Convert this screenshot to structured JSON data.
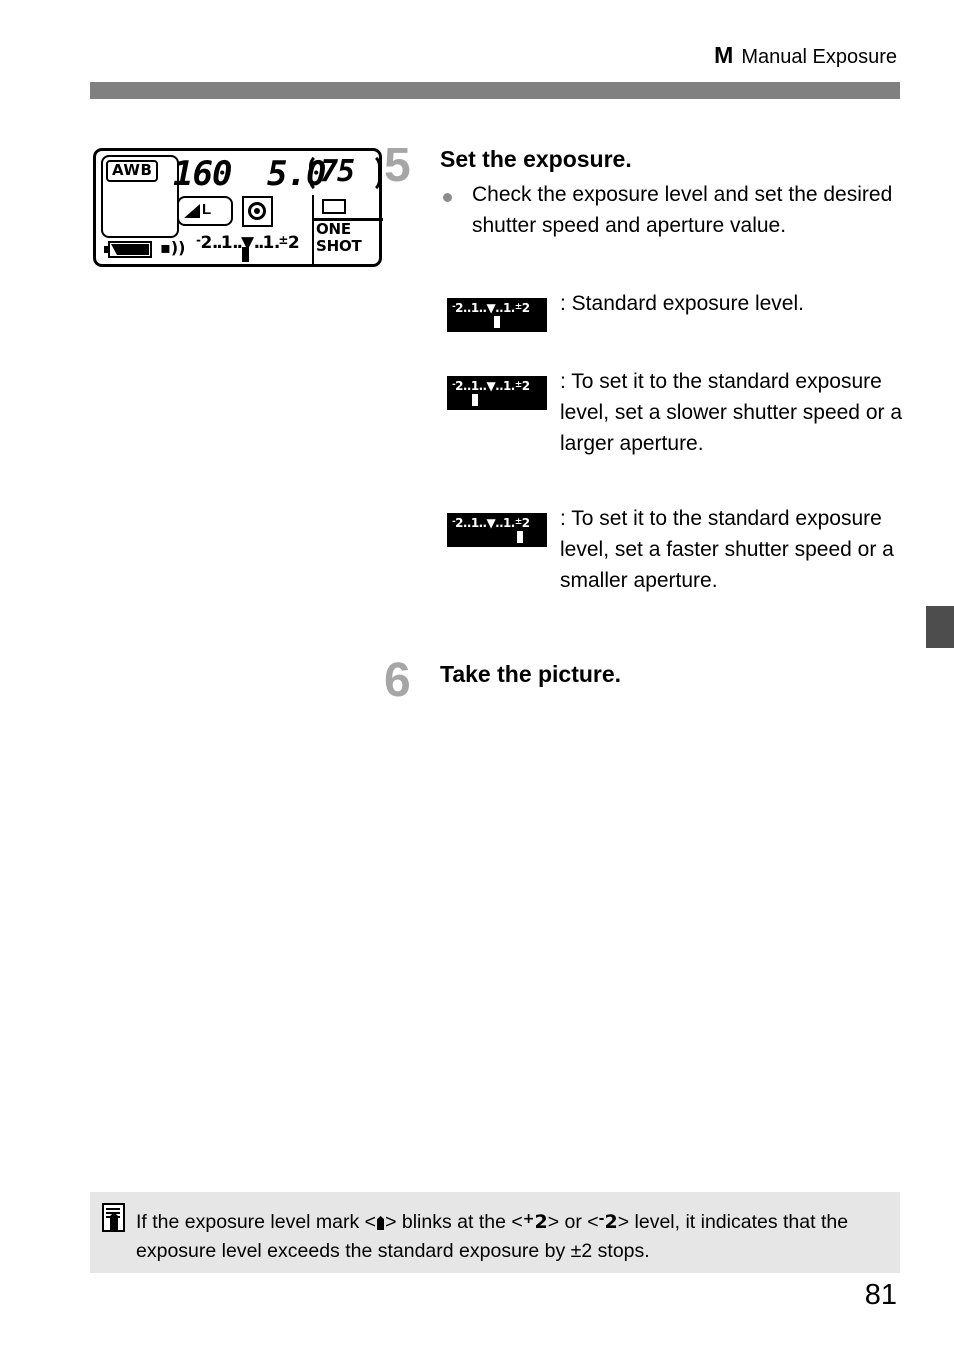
{
  "header": {
    "mode": "M",
    "title": "Manual Exposure"
  },
  "lcd": {
    "white_balance": "AWB",
    "shutter_speed": "160",
    "aperture": "5.0",
    "shots_remaining": "75",
    "quality": "L",
    "af_mode": "ONE SHOT",
    "exposure_scale": {
      "minus_sup": "-",
      "left_two": "2",
      "dots_a": "..",
      "left_one": "1",
      "dots_b": "..",
      "center_mark": "▼",
      "dots_c": "..",
      "right_one": "1",
      "dots_d": ".",
      "plusminus_sup": "±",
      "right_two": "2"
    }
  },
  "steps": [
    {
      "number": "5",
      "heading": "Set the exposure.",
      "bullet": "Check the exposure level and set the desired shutter speed and aperture value."
    },
    {
      "number": "6",
      "heading": "Take the picture."
    }
  ],
  "exposure_examples": [
    {
      "mark_position": "center",
      "label": ": Standard exposure level."
    },
    {
      "mark_position": "left",
      "label": ": To set it to the standard exposure level, set a slower shutter speed or a larger aperture."
    },
    {
      "mark_position": "right",
      "label": ": To set it to the standard exposure level, set a faster shutter speed or a smaller aperture."
    }
  ],
  "note": {
    "text_1": "If the exposure level mark <",
    "text_2": "> blinks at the <",
    "level_plus_sup": "+",
    "level_plus": "2",
    "text_3": "> or <",
    "level_minus_sup": "-",
    "level_minus": "2",
    "text_4": "> level, it indicates that the exposure level exceeds the standard exposure by ±2 stops."
  },
  "page_number": "81",
  "colors": {
    "header_bar": "#808080",
    "step_number": "#a6a6a6",
    "note_background": "#e6e6e6",
    "edge_tab": "#4d4d4d"
  }
}
